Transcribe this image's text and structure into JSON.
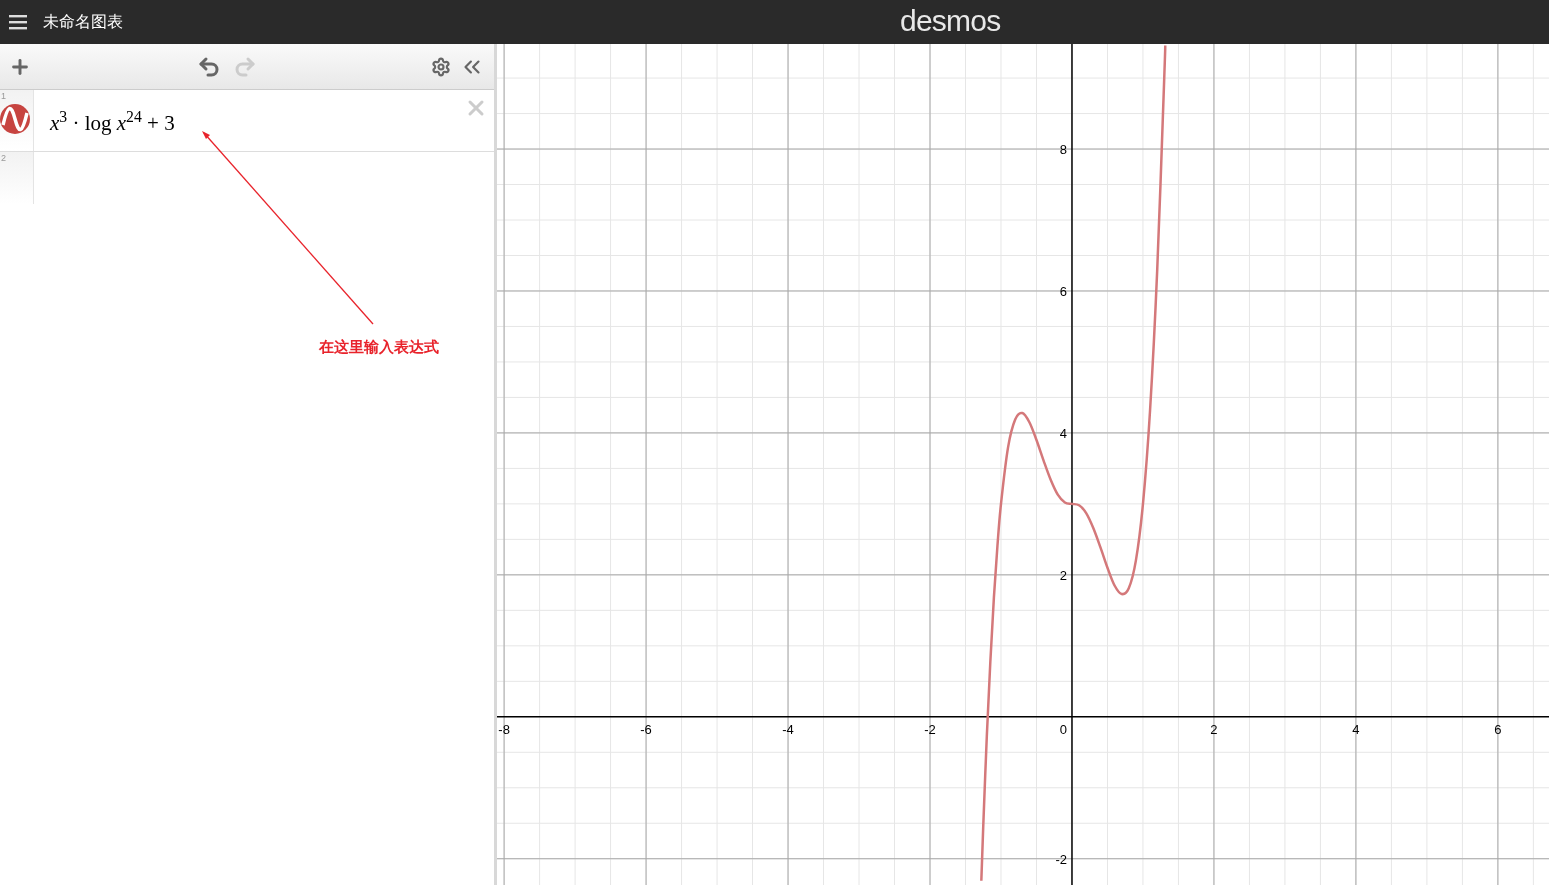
{
  "header": {
    "title": "未命名图表",
    "logo": "desmos"
  },
  "toolbar": {
    "undo": {
      "disabled": false
    },
    "redo": {
      "disabled": true
    }
  },
  "expressions": [
    {
      "number": "1",
      "formula": "*x*$^{3}$ · log *x*$^{24}$ + 3",
      "color": "#c74440"
    },
    {
      "number": "2"
    }
  ],
  "annotation": {
    "text": "在这里输入表达式"
  },
  "graph": {
    "chart_data": {
      "type": "line",
      "x": [
        -1.277,
        -1.25,
        -1.2,
        -1.15,
        -1.1,
        -1.05,
        -1.0,
        -0.9,
        -0.8,
        -0.7,
        -0.6,
        -0.5,
        -0.4,
        -0.3,
        -0.2,
        -0.1,
        0,
        0.1,
        0.2,
        0.3,
        0.4,
        0.5,
        0.6,
        0.7,
        0.8,
        0.9,
        1.0,
        1.1,
        1.2,
        1.3,
        1.314
      ],
      "series": [
        {
          "color": "#d4787a",
          "values": [
            -2.31,
            -1.54,
            -0.28,
            0.78,
            1.68,
            2.41,
            3,
            3.8,
            4.19,
            4.28,
            4.15,
            3.9,
            3.61,
            3.34,
            3.13,
            3.02,
            3,
            2.98,
            2.87,
            2.66,
            2.39,
            2.1,
            1.85,
            1.73,
            1.81,
            2.2,
            3,
            4.32,
            6.28,
            9.01,
            9.46
          ]
        }
      ],
      "xlim": [
        -8.1,
        6.72
      ],
      "ylim": [
        -2.37,
        9.48
      ],
      "grid": true,
      "xticks": [
        -8,
        -6,
        -4,
        -2,
        0,
        2,
        4,
        6
      ],
      "yticks": [
        -2,
        2,
        4,
        6,
        8
      ]
    }
  }
}
